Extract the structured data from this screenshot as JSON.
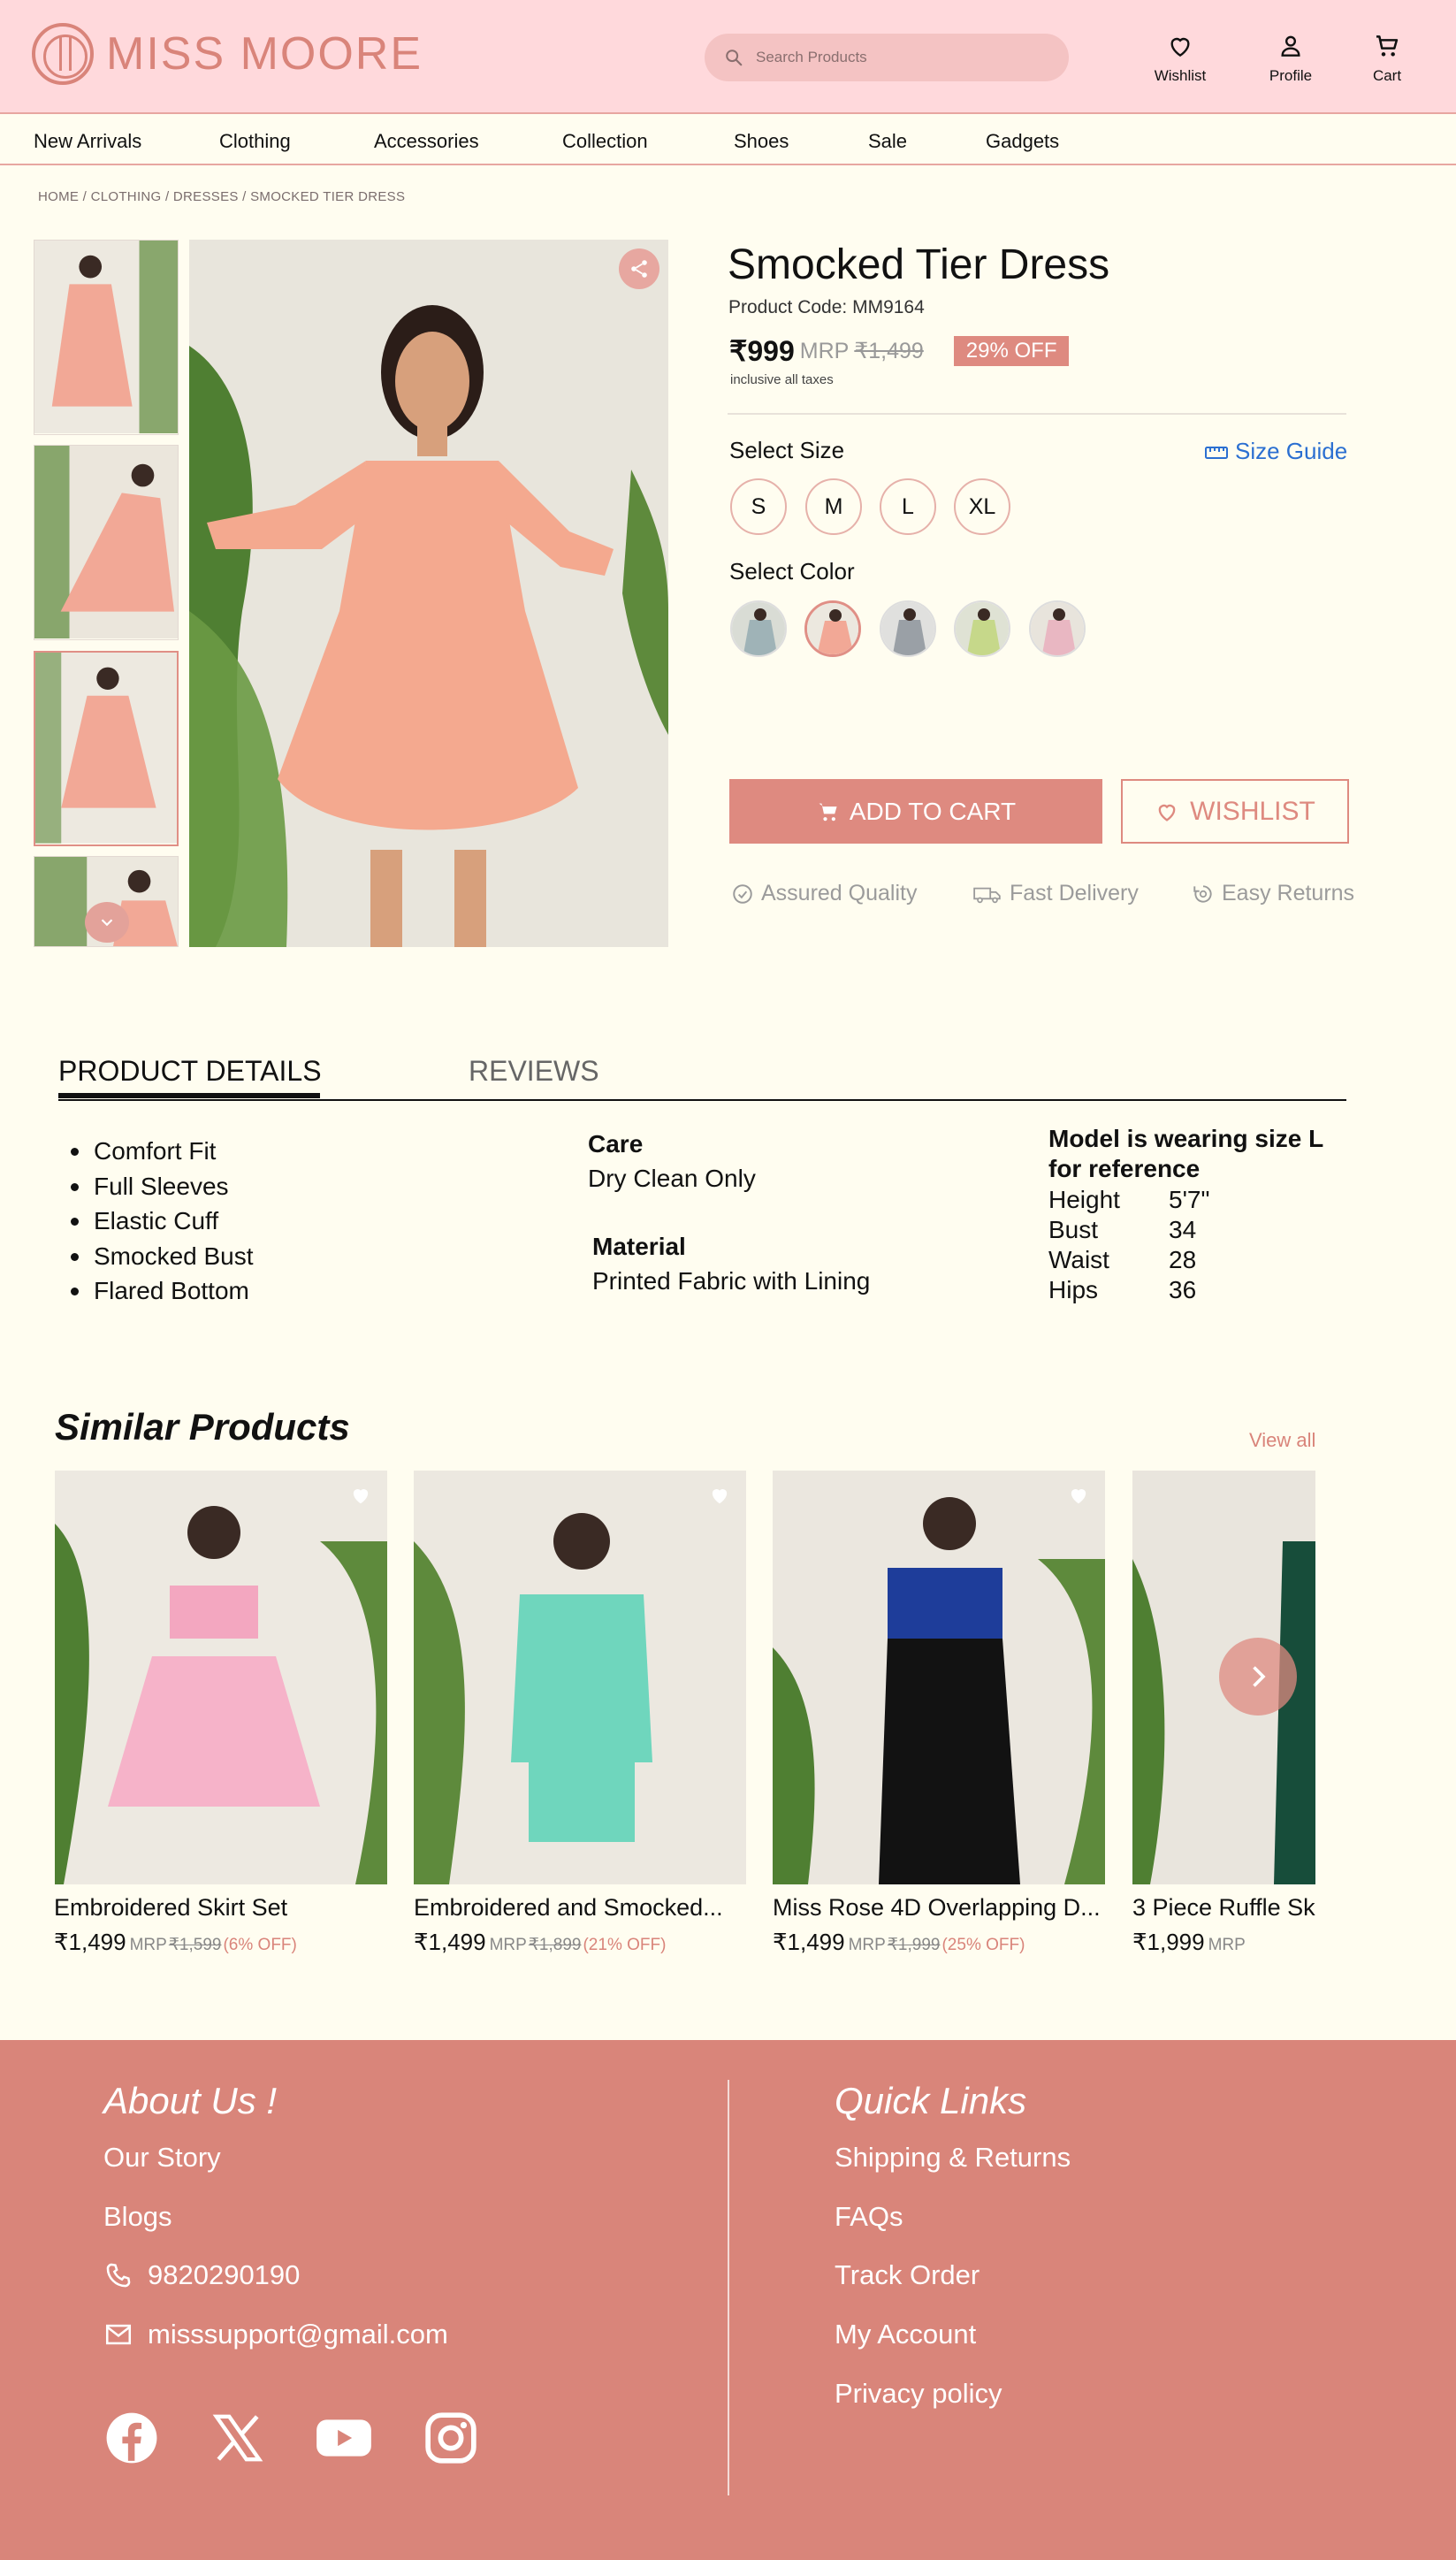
{
  "header": {
    "brand": "MISS MOORE",
    "search_placeholder": "Search Products",
    "wishlist": "Wishlist",
    "profile": "Profile",
    "cart": "Cart"
  },
  "nav": [
    "New Arrivals",
    "Clothing",
    "Accessories",
    "Collection",
    "Shoes",
    "Sale",
    "Gadgets"
  ],
  "breadcrumb": "HOME / CLOTHING / DRESSES / SMOCKED TIER DRESS",
  "product": {
    "title": "Smocked Tier Dress",
    "code": "Product Code: MM9164",
    "price": "₹999",
    "mrp_label": "MRP",
    "mrp": "₹1,499",
    "discount": "29% OFF",
    "tax_note": "inclusive all taxes",
    "select_size": "Select Size",
    "size_guide": "Size Guide",
    "sizes": [
      "S",
      "M",
      "L",
      "XL"
    ],
    "select_color": "Select Color",
    "add_to_cart": "ADD TO CART",
    "wishlist": "WISHLIST",
    "assurances": [
      "Assured Quality",
      "Fast Delivery",
      "Easy Returns"
    ]
  },
  "tabs": {
    "details": "PRODUCT DETAILS",
    "reviews": "REVIEWS"
  },
  "details": {
    "features": [
      "Comfort Fit",
      "Full Sleeves",
      "Elastic Cuff",
      "Smocked Bust",
      "Flared Bottom"
    ],
    "care_heading": "Care",
    "care_text": "Dry Clean Only",
    "material_heading": "Material",
    "material_text": "Printed Fabric with Lining",
    "model_heading": "Model is wearing size L for reference",
    "measurements": [
      {
        "k": "Height",
        "v": "5'7\""
      },
      {
        "k": "Bust",
        "v": "34"
      },
      {
        "k": "Waist",
        "v": "28"
      },
      {
        "k": "Hips",
        "v": "36"
      }
    ]
  },
  "similar": {
    "title": "Similar Products",
    "view_all": "View all",
    "items": [
      {
        "name": "Embroidered Skirt Set",
        "price": "₹1,499",
        "mrp_label": "MRP",
        "mrp": "₹1,599",
        "off": "(6% OFF)"
      },
      {
        "name": "Embroidered and Smocked...",
        "price": "₹1,499",
        "mrp_label": "MRP",
        "mrp": "₹1,899",
        "off": "(21% OFF)"
      },
      {
        "name": "Miss Rose 4D Overlapping D...",
        "price": "₹1,499",
        "mrp_label": "MRP",
        "mrp": "₹1,999",
        "off": "(25% OFF)"
      },
      {
        "name": "3 Piece Ruffle Sk",
        "price": "₹1,999",
        "mrp_label": "MRP",
        "mrp": "",
        "off": ""
      }
    ]
  },
  "footer": {
    "about_heading": "About Us !",
    "about_links": [
      "Our Story",
      "Blogs"
    ],
    "phone": "9820290190",
    "email": "misssupport@gmail.com",
    "quick_heading": "Quick Links",
    "quick_links": [
      "Shipping & Returns",
      "FAQs",
      "Track Order",
      "My Account",
      "Privacy policy"
    ]
  },
  "colors": {
    "accent": "#d9857a",
    "header_bg": "#ffd9dc",
    "page_bg": "#fffdf0",
    "link_blue": "#2b6fd1"
  },
  "icons": [
    "search-icon",
    "heart-icon",
    "user-icon",
    "cart-icon",
    "share-icon",
    "chevron-down-icon",
    "ruler-icon",
    "check-badge-icon",
    "truck-icon",
    "return-icon",
    "chevron-right-icon",
    "phone-icon",
    "mail-icon",
    "facebook-icon",
    "x-icon",
    "youtube-icon",
    "instagram-icon"
  ]
}
